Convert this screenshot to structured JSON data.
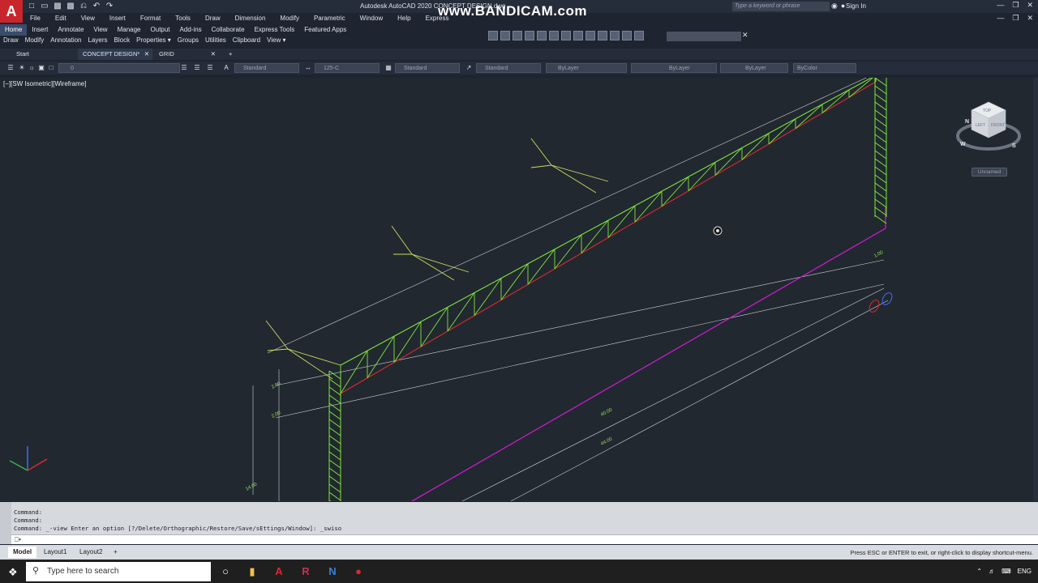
{
  "app": {
    "logo": "A",
    "title": "Autodesk AutoCAD 2020  CONCEPT DESIGN.dwg",
    "watermark": "www.BANDICAM.com",
    "search_placeholder": "Type a keyword or phrase",
    "sign_in": "Sign In"
  },
  "menubar": [
    "File",
    "Edit",
    "View",
    "Insert",
    "Format",
    "Tools",
    "Draw",
    "Dimension",
    "Modify",
    "Parametric",
    "Window",
    "Help",
    "Express"
  ],
  "ribbon_tabs": [
    "Home",
    "Insert",
    "Annotate",
    "View",
    "Manage",
    "Output",
    "Add-ins",
    "Collaborate",
    "Express Tools",
    "Featured Apps"
  ],
  "ribbon_panels": [
    "Draw",
    "Modify",
    "Annotation",
    "Layers",
    "Block",
    "Properties ▾",
    "Groups",
    "Utilities",
    "Clipboard",
    "View ▾"
  ],
  "doc_tabs": [
    {
      "label": "Start",
      "active": false
    },
    {
      "label": "CONCEPT DESIGN*",
      "active": true
    },
    {
      "label": "GRID",
      "active": false
    }
  ],
  "props": {
    "layer": "0",
    "text_style": "Standard",
    "dim_style": "125-C",
    "table_style": "Standard",
    "mleader_style": "Standard",
    "color": "ByLayer",
    "linetype": "ByLayer",
    "lineweight": "ByLayer",
    "plotstyle": "ByColor"
  },
  "viewport": {
    "label": "[−][SW Isometric][Wireframe]",
    "viewcube_faces": [
      "TOP",
      "LEFT",
      "FRONT"
    ],
    "compass": [
      "N",
      "W",
      "S"
    ],
    "named_view": "Unnamed"
  },
  "dimensions": [
    "1.00",
    "2.00",
    "2.00",
    "14.00",
    "40.00",
    "44.00"
  ],
  "command": {
    "lines": [
      "Command:",
      "Command:",
      "Command: _-view Enter an option [?/Delete/Orthographic/Restore/Save/sEttings/Window]: _swiso"
    ]
  },
  "layouts": [
    "Model",
    "Layout1",
    "Layout2"
  ],
  "status_message": "Press ESC or ENTER to exit, or right-click to display shortcut-menu.",
  "taskbar": {
    "search": "Type here to search",
    "lang": "ENG"
  },
  "colors": {
    "truss": "#7ee63a",
    "chord_red": "#e02b2b",
    "grid_line": "#cfd3da",
    "magenta": "#d61ad6",
    "dim": "#9ee35a"
  }
}
